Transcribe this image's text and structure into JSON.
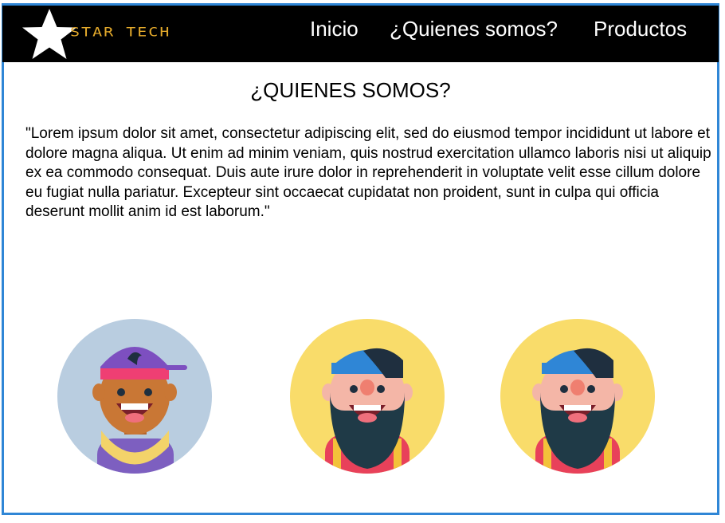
{
  "header": {
    "brand": "STAR TECH",
    "nav": [
      "Inicio",
      "¿Quienes somos?",
      "Productos"
    ]
  },
  "main": {
    "title": "¿QUIENES SOMOS?",
    "paragraph": "\"Lorem ipsum dolor sit amet, consectetur adipiscing elit, sed do eiusmod tempor incididunt ut labore et dolore magna aliqua. Ut enim ad minim veniam, quis nostrud exercitation ullamco laboris nisi ut aliquip ex ea commodo consequat. Duis aute irure dolor in reprehenderit in voluptate velit esse cillum dolore eu fugiat nulla pariatur. Excepteur sint occaecat cupidatat non proident, sunt in culpa qui officia deserunt mollit anim id est laborum.\""
  },
  "team": [
    {
      "icon": "cap-boy-avatar-icon"
    },
    {
      "icon": "bearded-man-avatar-icon"
    },
    {
      "icon": "bearded-man-avatar-icon"
    }
  ],
  "colors": {
    "navbar": "#000000",
    "brand": "#e3a92b",
    "frame_border": "#2f86d6",
    "avatar_bg_blue": "#b9cde0",
    "avatar_bg_yellow": "#f9dc6a"
  }
}
